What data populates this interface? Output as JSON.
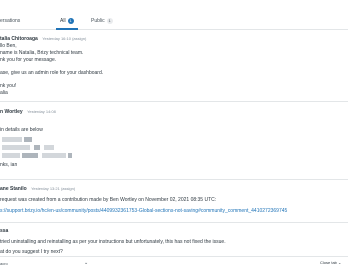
{
  "tabs": {
    "conversations": "ersations",
    "conversations_count": "",
    "all": "All",
    "all_count": "1",
    "public": "Public",
    "public_count": "1"
  },
  "messages": [
    {
      "author": "talia Chitoroaga",
      "time": "Yesterday 16:10 (assign)",
      "lines": [
        "llo Ben,",
        "name is Natalia, Brizy technical team.",
        "nk you for your message.",
        "ase, give us an admin role for your dashboard.",
        "nk you!",
        "alia"
      ]
    },
    {
      "author": "n Wortley",
      "time": "Yesterday 14:08",
      "lines": [
        "in details are below",
        "nks, ian"
      ]
    },
    {
      "author": "ane Stanilo",
      "time": "Yesterday 13:21 (assign)",
      "lines": [
        "request was created from a contribution made by Ben Wortley on November 02, 2021 08:35 UTC:",
        "s://support.brizy.io/hc/en-us/community/posts/4409932361753-Global-sections-not-saving#community_comment_4410272369745"
      ]
    },
    {
      "author": "ssa",
      "lines": [
        "tried uninstalling and reinstalling as per your instructions but unfortunately, this has not fixed the issue.",
        "at do you suggest I try next?"
      ]
    }
  ],
  "footer": {
    "left_label": "acro",
    "close_tab_label": "Close tab",
    "chevron_icon": "chevron-down-icon"
  },
  "colors": {
    "accent": "#1f73b7",
    "text": "#2f3941",
    "muted": "#87929d",
    "divider": "#e3e6e8"
  }
}
